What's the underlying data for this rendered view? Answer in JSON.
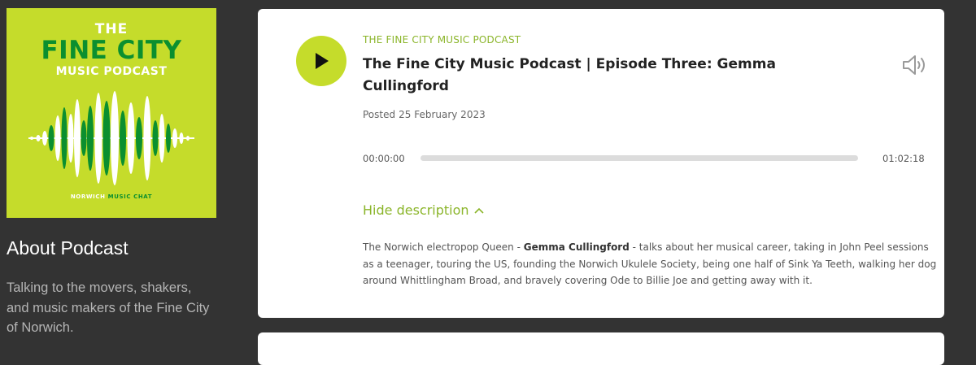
{
  "sidebar": {
    "cover": {
      "line1": "THE",
      "line2": "FINE CITY",
      "line3": "MUSIC PODCAST",
      "tag_white": "NORWICH",
      "tag_green": "MUSIC CHAT",
      "colors": {
        "background": "#c5dc2b",
        "green": "#0b8f2f",
        "white": "#ffffff"
      }
    },
    "about_heading": "About Podcast",
    "about_text": "Talking to the movers, shakers, and music makers of the Fine City of Norwich."
  },
  "episode": {
    "podcast_name": "THE FINE CITY MUSIC PODCAST",
    "title": "The Fine City Music Podcast | Episode Three: Gemma Cullingford",
    "posted_label": "Posted",
    "posted_date": "25 February 2023",
    "current_time": "00:00:00",
    "duration": "01:02:18",
    "progress": 0,
    "toggle_label": "Hide description",
    "description": {
      "part1": "The Norwich electropop Queen - ",
      "bold": "Gemma Cullingford",
      "part2": " - talks about her musical career, taking in John Peel sessions as a teenager, touring the US, founding the Norwich Ukulele Society, being one half of Sink Ya Teeth, walking her dog around Whittlingham Broad, and bravely covering Ode to Billie Joe and getting away with it."
    },
    "icons": {
      "play": "play-icon",
      "volume": "volume-icon",
      "toggle": "chevron-up-icon"
    },
    "colors": {
      "accent": "#c5dc2b",
      "link": "#8bb52a",
      "page_bg": "#333333"
    }
  }
}
